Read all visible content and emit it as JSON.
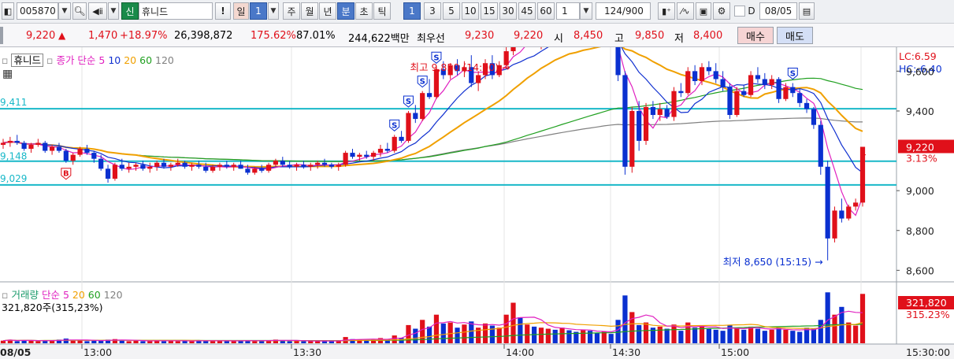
{
  "toolbar": {
    "stock_code": "005870",
    "credit_badge": "신",
    "stock_name": "휴니드",
    "period_daily": "일",
    "period_num": "1",
    "periods": [
      "주",
      "월",
      "년",
      "분",
      "초",
      "틱"
    ],
    "active_period": "분",
    "intervals": [
      "1",
      "3",
      "5",
      "10",
      "15",
      "30",
      "45",
      "60"
    ],
    "active_interval": "1",
    "interval_select": "1",
    "view_count": "124",
    "view_total": "/900",
    "d_checkbox_label": "D",
    "date": "08/05",
    "exclaim": "!"
  },
  "quote": {
    "price": "9,220",
    "change_arrow": "▲",
    "change": "1,470",
    "change_pct": "+18.97%",
    "volume": "26,398,872",
    "volume_ratio": "175.62%",
    "strength": "87.01%",
    "amount": "244,622백만",
    "best_ask_label": "최우선",
    "best_ask": "9,230",
    "best_bid": "9,220",
    "open_label": "시",
    "open": "8,450",
    "high_label": "고",
    "high": "9,850",
    "low_label": "저",
    "low": "8,400",
    "buy_button": "매수",
    "sell_button": "매도"
  },
  "price_legend": {
    "name_box": "휴니드",
    "ma_label": "종가 단순",
    "ma_periods": [
      "5",
      "10",
      "20",
      "60",
      "120"
    ]
  },
  "volume_legend": {
    "title": "거래량",
    "ma_label": "단순",
    "ma_periods": [
      "5",
      "20",
      "60",
      "120"
    ],
    "value": "321,820주(315,23%)"
  },
  "price_axis": {
    "lc": "LC:6.59",
    "hc": "HC:-6.40",
    "ticks": [
      "9,600",
      "9,400",
      "9,000",
      "8,800",
      "8,600"
    ],
    "current_price": "9,220",
    "current_pct": "3.13%"
  },
  "volume_axis": {
    "current": "321,820",
    "pct": "315.23%"
  },
  "hlines": {
    "labels": [
      "9,411",
      "9,148",
      "9,029"
    ],
    "values": [
      9411,
      9148,
      9029,
      9138,
      9410
    ]
  },
  "annotations": {
    "high": "최고 9,850 (14:00) →",
    "low": "최저 8,650 (15:15) →"
  },
  "time_axis": {
    "labels": [
      "08/05",
      "13:00",
      "13:30",
      "14:00",
      "14:30",
      "15:00",
      "15:30:00"
    ]
  },
  "signals": [
    "B",
    "S",
    "S",
    "S",
    "S",
    "S"
  ],
  "colors": {
    "up": "#e0101a",
    "down": "#0a30d0",
    "ma5": "#e020c0",
    "ma10": "#1030d0",
    "ma20": "#f0a000",
    "ma60": "#20a020",
    "ma120": "#808080",
    "hline": "#18b8c8"
  },
  "chart_data": {
    "type": "candlestick",
    "x_labels": [
      "13:00",
      "13:30",
      "14:00",
      "14:30",
      "15:00",
      "15:30"
    ],
    "y_range": [
      8550,
      9720
    ],
    "price_high": 9850,
    "price_low": 8650,
    "close": 9220,
    "candles": [
      [
        9230,
        9260,
        9210,
        9240
      ],
      [
        9240,
        9270,
        9220,
        9250
      ],
      [
        9250,
        9280,
        9230,
        9240
      ],
      [
        9240,
        9250,
        9200,
        9210
      ],
      [
        9210,
        9240,
        9190,
        9230
      ],
      [
        9230,
        9260,
        9220,
        9240
      ],
      [
        9240,
        9250,
        9190,
        9200
      ],
      [
        9200,
        9230,
        9180,
        9220
      ],
      [
        9220,
        9240,
        9190,
        9200
      ],
      [
        9200,
        9210,
        9140,
        9150
      ],
      [
        9150,
        9190,
        9130,
        9180
      ],
      [
        9180,
        9220,
        9170,
        9210
      ],
      [
        9210,
        9230,
        9180,
        9190
      ],
      [
        9190,
        9200,
        9140,
        9160
      ],
      [
        9160,
        9180,
        9100,
        9110
      ],
      [
        9110,
        9130,
        9040,
        9060
      ],
      [
        9060,
        9140,
        9050,
        9130
      ],
      [
        9130,
        9160,
        9100,
        9110
      ],
      [
        9110,
        9140,
        9090,
        9120
      ],
      [
        9120,
        9140,
        9100,
        9130
      ],
      [
        9130,
        9150,
        9100,
        9110
      ],
      [
        9110,
        9140,
        9090,
        9120
      ],
      [
        9120,
        9150,
        9100,
        9140
      ],
      [
        9140,
        9160,
        9110,
        9120
      ],
      [
        9120,
        9140,
        9100,
        9130
      ],
      [
        9130,
        9160,
        9120,
        9140
      ],
      [
        9140,
        9150,
        9110,
        9120
      ],
      [
        9120,
        9140,
        9100,
        9130
      ],
      [
        9130,
        9150,
        9110,
        9120
      ],
      [
        9120,
        9140,
        9090,
        9100
      ],
      [
        9100,
        9130,
        9090,
        9120
      ],
      [
        9120,
        9140,
        9100,
        9130
      ],
      [
        9130,
        9150,
        9110,
        9120
      ],
      [
        9120,
        9140,
        9100,
        9130
      ],
      [
        9130,
        9150,
        9110,
        9110
      ],
      [
        9110,
        9130,
        9080,
        9090
      ],
      [
        9090,
        9120,
        9080,
        9110
      ],
      [
        9110,
        9130,
        9090,
        9100
      ],
      [
        9100,
        9140,
        9090,
        9130
      ],
      [
        9130,
        9160,
        9120,
        9150
      ],
      [
        9150,
        9170,
        9120,
        9130
      ],
      [
        9130,
        9150,
        9110,
        9120
      ],
      [
        9120,
        9140,
        9100,
        9130
      ],
      [
        9130,
        9150,
        9110,
        9120
      ],
      [
        9120,
        9140,
        9100,
        9130
      ],
      [
        9130,
        9150,
        9110,
        9140
      ],
      [
        9140,
        9160,
        9120,
        9130
      ],
      [
        9130,
        9140,
        9110,
        9120
      ],
      [
        9120,
        9140,
        9100,
        9130
      ],
      [
        9130,
        9200,
        9120,
        9190
      ],
      [
        9190,
        9210,
        9160,
        9170
      ],
      [
        9170,
        9190,
        9150,
        9180
      ],
      [
        9180,
        9200,
        9160,
        9170
      ],
      [
        9170,
        9200,
        9150,
        9190
      ],
      [
        9190,
        9230,
        9170,
        9210
      ],
      [
        9210,
        9240,
        9190,
        9200
      ],
      [
        9200,
        9280,
        9190,
        9270
      ],
      [
        9270,
        9300,
        9240,
        9250
      ],
      [
        9250,
        9400,
        9240,
        9390
      ],
      [
        9390,
        9430,
        9340,
        9360
      ],
      [
        9360,
        9500,
        9350,
        9490
      ],
      [
        9490,
        9560,
        9460,
        9470
      ],
      [
        9470,
        9620,
        9460,
        9610
      ],
      [
        9610,
        9650,
        9560,
        9580
      ],
      [
        9580,
        9640,
        9560,
        9630
      ],
      [
        9630,
        9660,
        9580,
        9600
      ],
      [
        9600,
        9650,
        9570,
        9620
      ],
      [
        9620,
        9680,
        9520,
        9540
      ],
      [
        9540,
        9600,
        9500,
        9580
      ],
      [
        9580,
        9660,
        9560,
        9640
      ],
      [
        9640,
        9680,
        9560,
        9580
      ],
      [
        9580,
        9650,
        9570,
        9630
      ],
      [
        9630,
        9720,
        9610,
        9700
      ],
      [
        9700,
        9850,
        9680,
        9810
      ],
      [
        9810,
        9840,
        9740,
        9760
      ],
      [
        9760,
        9800,
        9720,
        9780
      ],
      [
        9780,
        9820,
        9740,
        9750
      ],
      [
        9750,
        9790,
        9710,
        9770
      ],
      [
        9770,
        9810,
        9740,
        9790
      ],
      [
        9790,
        9830,
        9760,
        9780
      ],
      [
        9780,
        9820,
        9740,
        9800
      ],
      [
        9800,
        9830,
        9760,
        9780
      ],
      [
        9780,
        9810,
        9740,
        9760
      ],
      [
        9760,
        9800,
        9730,
        9790
      ],
      [
        9790,
        9820,
        9750,
        9770
      ],
      [
        9770,
        9800,
        9740,
        9760
      ],
      [
        9760,
        9790,
        9730,
        9770
      ],
      [
        9770,
        9780,
        9720,
        9740
      ],
      [
        9740,
        9760,
        9550,
        9580
      ],
      [
        9580,
        9600,
        9080,
        9120
      ],
      [
        9120,
        9420,
        9090,
        9400
      ],
      [
        9400,
        9450,
        9200,
        9250
      ],
      [
        9250,
        9440,
        9230,
        9420
      ],
      [
        9420,
        9450,
        9360,
        9380
      ],
      [
        9380,
        9440,
        9350,
        9410
      ],
      [
        9410,
        9430,
        9360,
        9370
      ],
      [
        9370,
        9520,
        9350,
        9500
      ],
      [
        9500,
        9540,
        9470,
        9490
      ],
      [
        9490,
        9620,
        9480,
        9600
      ],
      [
        9600,
        9630,
        9530,
        9550
      ],
      [
        9550,
        9640,
        9530,
        9620
      ],
      [
        9620,
        9650,
        9580,
        9600
      ],
      [
        9600,
        9640,
        9540,
        9560
      ],
      [
        9560,
        9600,
        9500,
        9520
      ],
      [
        9520,
        9540,
        9360,
        9380
      ],
      [
        9380,
        9520,
        9370,
        9500
      ],
      [
        9500,
        9530,
        9470,
        9480
      ],
      [
        9480,
        9600,
        9470,
        9580
      ],
      [
        9580,
        9620,
        9540,
        9560
      ],
      [
        9560,
        9590,
        9510,
        9530
      ],
      [
        9530,
        9580,
        9510,
        9560
      ],
      [
        9560,
        9570,
        9440,
        9460
      ],
      [
        9460,
        9540,
        9450,
        9520
      ],
      [
        9520,
        9540,
        9470,
        9490
      ],
      [
        9490,
        9510,
        9420,
        9440
      ],
      [
        9440,
        9460,
        9390,
        9410
      ],
      [
        9410,
        9420,
        9310,
        9330
      ],
      [
        9330,
        9350,
        9080,
        9120
      ],
      [
        9120,
        9150,
        8650,
        8760
      ],
      [
        8760,
        8920,
        8740,
        8900
      ],
      [
        8900,
        8960,
        8840,
        8860
      ],
      [
        8860,
        8930,
        8850,
        8920
      ],
      [
        8920,
        8960,
        8900,
        8940
      ],
      [
        8940,
        8980,
        8920,
        9220
      ]
    ],
    "volume_ratio": [
      0.05,
      0.07,
      0.04,
      0.06,
      0.05,
      0.04,
      0.06,
      0.05,
      0.07,
      0.09,
      0.05,
      0.06,
      0.04,
      0.05,
      0.06,
      0.07,
      0.08,
      0.05,
      0.04,
      0.05,
      0.04,
      0.05,
      0.06,
      0.04,
      0.05,
      0.04,
      0.05,
      0.04,
      0.06,
      0.05,
      0.04,
      0.05,
      0.04,
      0.05,
      0.06,
      0.05,
      0.04,
      0.05,
      0.06,
      0.07,
      0.05,
      0.04,
      0.05,
      0.04,
      0.05,
      0.04,
      0.05,
      0.04,
      0.05,
      0.12,
      0.08,
      0.07,
      0.06,
      0.07,
      0.1,
      0.08,
      0.15,
      0.1,
      0.35,
      0.28,
      0.45,
      0.32,
      0.55,
      0.38,
      0.4,
      0.3,
      0.36,
      0.42,
      0.3,
      0.38,
      0.34,
      0.3,
      0.55,
      0.78,
      0.5,
      0.36,
      0.32,
      0.3,
      0.28,
      0.26,
      0.3,
      0.25,
      0.22,
      0.26,
      0.24,
      0.2,
      0.22,
      0.18,
      0.45,
      0.92,
      0.6,
      0.35,
      0.4,
      0.3,
      0.32,
      0.28,
      0.36,
      0.24,
      0.4,
      0.3,
      0.34,
      0.28,
      0.26,
      0.24,
      0.35,
      0.3,
      0.26,
      0.32,
      0.28,
      0.24,
      0.26,
      0.3,
      0.26,
      0.24,
      0.22,
      0.3,
      0.28,
      0.45,
      0.98,
      0.55,
      0.7,
      0.4,
      0.34,
      0.95
    ],
    "series": [
      {
        "name": "5",
        "values": []
      },
      {
        "name": "10",
        "values": []
      },
      {
        "name": "20",
        "values": []
      },
      {
        "name": "60",
        "values": []
      },
      {
        "name": "120",
        "values": []
      }
    ]
  }
}
